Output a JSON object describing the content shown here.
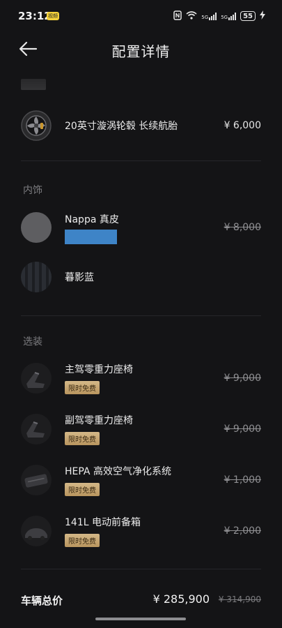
{
  "status_bar": {
    "time": "23:12",
    "pill": "视频",
    "icons": [
      "nfc-icon",
      "wifi-icon",
      "5g-signal-icon",
      "5g-signal-icon"
    ],
    "battery": "55"
  },
  "header": {
    "title": "配置详情"
  },
  "wheels": {
    "name": "20英寸漩涡轮毂 长续航胎",
    "price": "¥ 6,000"
  },
  "interior": {
    "label": "内饰",
    "items": [
      {
        "name": "Nappa 真皮",
        "price": "¥ 8,000",
        "struck": true
      },
      {
        "name": "暮影蓝",
        "price": ""
      }
    ]
  },
  "options": {
    "label": "选装",
    "items": [
      {
        "name": "主驾零重力座椅",
        "tag": "限时免费",
        "price": "¥ 9,000"
      },
      {
        "name": "副驾零重力座椅",
        "tag": "限时免费",
        "price": "¥ 9,000"
      },
      {
        "name": "HEPA 高效空气净化系统",
        "tag": "限时免费",
        "price": "¥ 1,000"
      },
      {
        "name": "141L 电动前备箱",
        "tag": "限时免费",
        "price": "¥ 2,000"
      }
    ]
  },
  "total": {
    "label": "车辆总价",
    "price": "¥ 285,900",
    "original": "¥ 314,900"
  },
  "colors": {
    "background": "#141416",
    "tag_gold": "#c9a873",
    "redaction_blue": "#3e84c7"
  }
}
